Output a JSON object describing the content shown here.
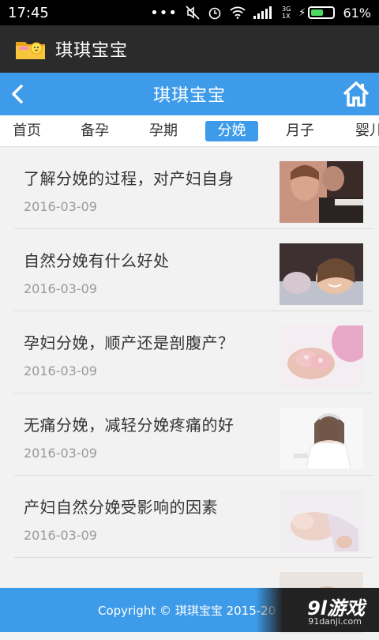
{
  "status": {
    "time": "17:45",
    "network": "3G\n1X",
    "battery_pct": "61%",
    "battery_level": 0.61
  },
  "app": {
    "title": "琪琪宝宝"
  },
  "nav": {
    "title": "琪琪宝宝"
  },
  "tabs": [
    {
      "label": "首页"
    },
    {
      "label": "备孕"
    },
    {
      "label": "孕期"
    },
    {
      "label": "分娩",
      "active": true
    },
    {
      "label": "月子"
    },
    {
      "label": "婴儿"
    }
  ],
  "articles": [
    {
      "title": "了解分娩的过程，对产妇自身",
      "date": "2016-03-09",
      "thumb": "couple-photo"
    },
    {
      "title": "自然分娩有什么好处",
      "date": "2016-03-09",
      "thumb": "smiling-mother-photo"
    },
    {
      "title": "孕妇分娩，顺产还是剖腹产？",
      "date": "2016-03-09",
      "thumb": "baby-shoes-photo"
    },
    {
      "title": "无痛分娩，减轻分娩疼痛的好",
      "date": "2016-03-09",
      "thumb": "bride-photo"
    },
    {
      "title": "产妇自然分娩受影响的因素",
      "date": "2016-03-09",
      "thumb": "pregnant-belly-photo"
    }
  ],
  "footer": {
    "text": "Copyright © 琪琪宝宝 2015-20"
  },
  "watermark": {
    "logo": "9l游戏",
    "url": "91danji.com"
  },
  "colors": {
    "primary": "#3d9be9",
    "app_bar": "#2b2b2b",
    "status_bar": "#000000"
  }
}
